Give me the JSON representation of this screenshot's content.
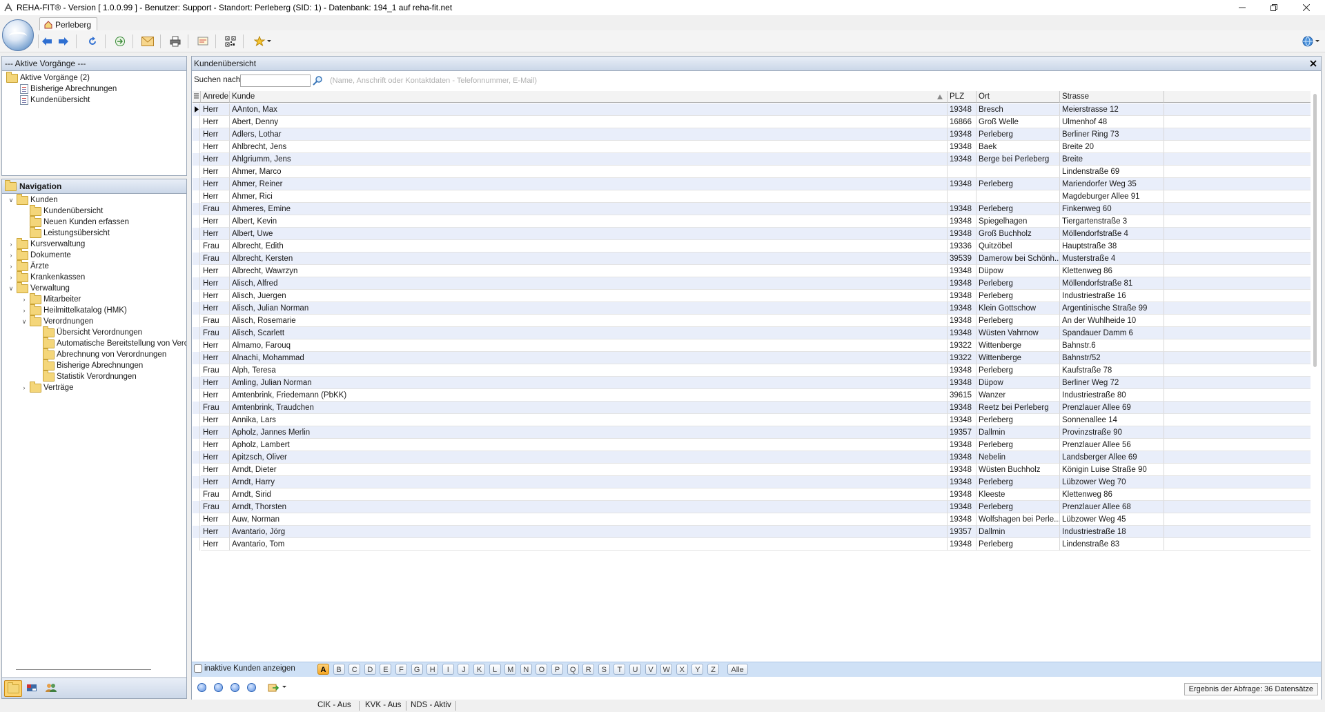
{
  "window": {
    "title": "REHA-FIT® - Version [ 1.0.0.99 ] - Benutzer: Support - Standort: Perleberg  (SID: 1) - Datenbank: 194_1 auf reha-fit.net",
    "tab_label": "Perleberg"
  },
  "active_panel": {
    "header": "--- Aktive Vorgänge ---",
    "items": [
      {
        "label": "Aktive Vorgänge (2)"
      },
      {
        "label": "Bisherige Abrechnungen"
      },
      {
        "label": "Kundenübersicht"
      }
    ]
  },
  "nav_panel": {
    "header": "Navigation",
    "items": [
      {
        "label": "Kunden"
      },
      {
        "label": "Kundenübersicht"
      },
      {
        "label": "Neuen Kunden erfassen"
      },
      {
        "label": "Leistungsübersicht"
      },
      {
        "label": "Kursverwaltung"
      },
      {
        "label": "Dokumente"
      },
      {
        "label": "Ärzte"
      },
      {
        "label": "Krankenkassen"
      },
      {
        "label": "Verwaltung"
      },
      {
        "label": "Mitarbeiter"
      },
      {
        "label": "Heilmittelkatalog (HMK)"
      },
      {
        "label": "Verordnungen"
      },
      {
        "label": "Übersicht Verordnungen"
      },
      {
        "label": "Automatische Bereitstellung von Verordnungen"
      },
      {
        "label": "Abrechnung von Verordnungen"
      },
      {
        "label": "Bisherige Abrechnungen"
      },
      {
        "label": "Statistik Verordnungen"
      },
      {
        "label": "Verträge"
      }
    ]
  },
  "main": {
    "header": "Kundenübersicht",
    "search_label": "Suchen nach:",
    "search_value": "",
    "search_hint": "(Name, Anschrift oder Kontaktdaten - Telefonnummer, E-Mail)",
    "columns": [
      "Anrede",
      "Kunde",
      "PLZ",
      "Ort",
      "Strasse"
    ],
    "rows": [
      [
        "Herr",
        "AAnton, Max",
        "19348",
        "Bresch",
        "Meierstrasse 12"
      ],
      [
        "Herr",
        "Abert, Denny",
        "16866",
        "Groß Welle",
        "Ulmenhof 48"
      ],
      [
        "Herr",
        "Adlers, Lothar",
        "19348",
        "Perleberg",
        "Berliner Ring 73"
      ],
      [
        "Herr",
        "Ahlbrecht, Jens",
        "19348",
        "Baek",
        "Breite 20"
      ],
      [
        "Herr",
        "Ahlgriumm, Jens",
        "19348",
        "Berge bei Perleberg",
        "Breite"
      ],
      [
        "Herr",
        "Ahmer, Marco",
        "",
        "",
        "Lindenstraße 69"
      ],
      [
        "Herr",
        "Ahmer, Reiner",
        "19348",
        "Perleberg",
        "Mariendorfer Weg 35"
      ],
      [
        "Herr",
        "Ahmer, Rici",
        "",
        "",
        "Magdeburger Allee 91"
      ],
      [
        "Frau",
        "Ahmeres, Emine",
        "19348",
        "Perleberg",
        "Finkenweg 60"
      ],
      [
        "Herr",
        "Albert, Kevin",
        "19348",
        "Spiegelhagen",
        "Tiergartenstraße 3"
      ],
      [
        "Herr",
        "Albert, Uwe",
        "19348",
        "Groß Buchholz",
        "Möllendorfstraße 4"
      ],
      [
        "Frau",
        "Albrecht, Edith",
        "19336",
        "Quitzöbel",
        "Hauptstraße 38"
      ],
      [
        "Frau",
        "Albrecht, Kersten",
        "39539",
        "Damerow bei Schönh...",
        "Musterstraße 4"
      ],
      [
        "Herr",
        "Albrecht, Wawrzyn",
        "19348",
        "Düpow",
        "Klettenweg 86"
      ],
      [
        "Herr",
        "Alisch, Alfred",
        "19348",
        "Perleberg",
        "Möllendorfstraße 81"
      ],
      [
        "Herr",
        "Alisch, Juergen",
        "19348",
        "Perleberg",
        "Industriestraße 16"
      ],
      [
        "Herr",
        "Alisch, Julian Norman",
        "19348",
        "Klein Gottschow",
        "Argentinische Straße 99"
      ],
      [
        "Frau",
        "Alisch, Rosemarie",
        "19348",
        "Perleberg",
        "An der Wuhlheide 10"
      ],
      [
        "Frau",
        "Alisch, Scarlett",
        "19348",
        "Wüsten Vahrnow",
        "Spandauer Damm 6"
      ],
      [
        "Herr",
        "Almamo, Farouq",
        "19322",
        "Wittenberge",
        "Bahnstr.6"
      ],
      [
        "Herr",
        "Alnachi, Mohammad",
        "19322",
        "Wittenberge",
        "Bahnstr/52"
      ],
      [
        "Frau",
        "Alph, Teresa",
        "19348",
        "Perleberg",
        "Kaufstraße 78"
      ],
      [
        "Herr",
        "Amling, Julian Norman",
        "19348",
        "Düpow",
        "Berliner Weg 72"
      ],
      [
        "Herr",
        "Amtenbrink, Friedemann (PbKK)",
        "39615",
        "Wanzer",
        "Industriestraße 80"
      ],
      [
        "Frau",
        "Amtenbrink, Traudchen",
        "19348",
        "Reetz bei Perleberg",
        "Prenzlauer Allee 69"
      ],
      [
        "Herr",
        "Annika, Lars",
        "19348",
        "Perleberg",
        "Sonnenallee 14"
      ],
      [
        "Herr",
        "Apholz, Jannes Merlin",
        "19357",
        "Dallmin",
        "Provinzstraße 90"
      ],
      [
        "Herr",
        "Apholz, Lambert",
        "19348",
        "Perleberg",
        "Prenzlauer Allee 56"
      ],
      [
        "Herr",
        "Apitzsch, Oliver",
        "19348",
        "Nebelin",
        "Landsberger Allee 69"
      ],
      [
        "Herr",
        "Arndt, Dieter",
        "19348",
        "Wüsten Buchholz",
        "Königin Luise Straße 90"
      ],
      [
        "Herr",
        "Arndt, Harry",
        "19348",
        "Perleberg",
        "Lübzower Weg 70"
      ],
      [
        "Frau",
        "Arndt, Sirid",
        "19348",
        "Kleeste",
        "Klettenweg 86"
      ],
      [
        "Frau",
        "Arndt, Thorsten",
        "19348",
        "Perleberg",
        "Prenzlauer Allee 68"
      ],
      [
        "Herr",
        "Auw, Norman",
        "19348",
        "Wolfshagen bei Perle...",
        "Lübzower Weg 45"
      ],
      [
        "Herr",
        "Avantario, Jörg",
        "19357",
        "Dallmin",
        "Industriestraße 18"
      ],
      [
        "Herr",
        "Avantario, Tom",
        "19348",
        "Perleberg",
        "Lindenstraße 83"
      ]
    ],
    "inactive_label": "inaktive Kunden anzeigen",
    "letters": [
      "A",
      "B",
      "C",
      "D",
      "E",
      "F",
      "G",
      "H",
      "I",
      "J",
      "K",
      "L",
      "M",
      "N",
      "O",
      "P",
      "Q",
      "R",
      "S",
      "T",
      "U",
      "V",
      "W",
      "X",
      "Y",
      "Z",
      "Alle"
    ],
    "active_letter": "A",
    "result_text": "Ergebnis  der  Abfrage:  36  Datensätze"
  },
  "status": {
    "items": [
      "CIK - Aus",
      "KVK - Aus",
      "NDS - Aktiv"
    ]
  }
}
